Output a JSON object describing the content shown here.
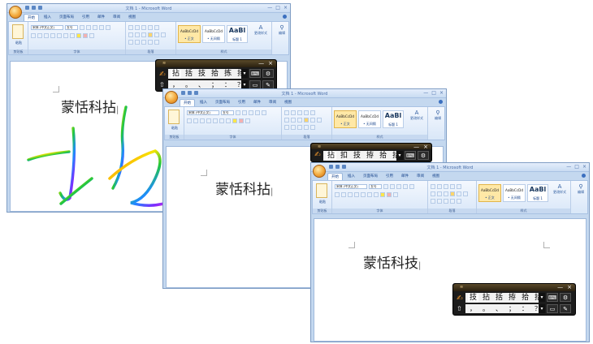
{
  "word": {
    "title": "文档 1 - Microsoft Word",
    "tabs": [
      "开始",
      "插入",
      "页面布局",
      "引用",
      "邮件",
      "审阅",
      "视图"
    ],
    "font_name": "宋体 (中文正文)",
    "font_size": "五号",
    "paste_label": "粘贴",
    "groups": [
      "剪贴板",
      "字体",
      "段落",
      "样式",
      "编辑"
    ],
    "styles": [
      {
        "preview": "AaBbCcDd",
        "name": "• 正文"
      },
      {
        "preview": "AaBbCcDd",
        "name": "• 无间隔"
      },
      {
        "preview": "AaBl",
        "name": "标题 1"
      }
    ],
    "change_styles": "更改样式",
    "edit_label": "编辑"
  },
  "panels": [
    {
      "doc_text": "蒙恬科拈",
      "ime_candidates": [
        "拈",
        "括",
        "技",
        "拾",
        "拣",
        "扬"
      ]
    },
    {
      "doc_text": "蒙恬科拈",
      "ime_candidates": [
        "拈",
        "扣",
        "技",
        "拵",
        "拾",
        "括"
      ]
    },
    {
      "doc_text": "蒙恬科技",
      "ime_candidates": [
        "技",
        "拈",
        "括",
        "拵",
        "拾",
        "括"
      ]
    }
  ],
  "ime": {
    "punct": [
      "，",
      "。",
      "、",
      "；",
      "：",
      "？"
    ],
    "close": "×",
    "minimize": "—"
  },
  "handwriting": {
    "stroke_colors": [
      "#ff1e1e",
      "#ff9a00",
      "#f6e400",
      "#22c83a",
      "#1e8cff",
      "#7a2cff",
      "#ff2fd0"
    ]
  }
}
